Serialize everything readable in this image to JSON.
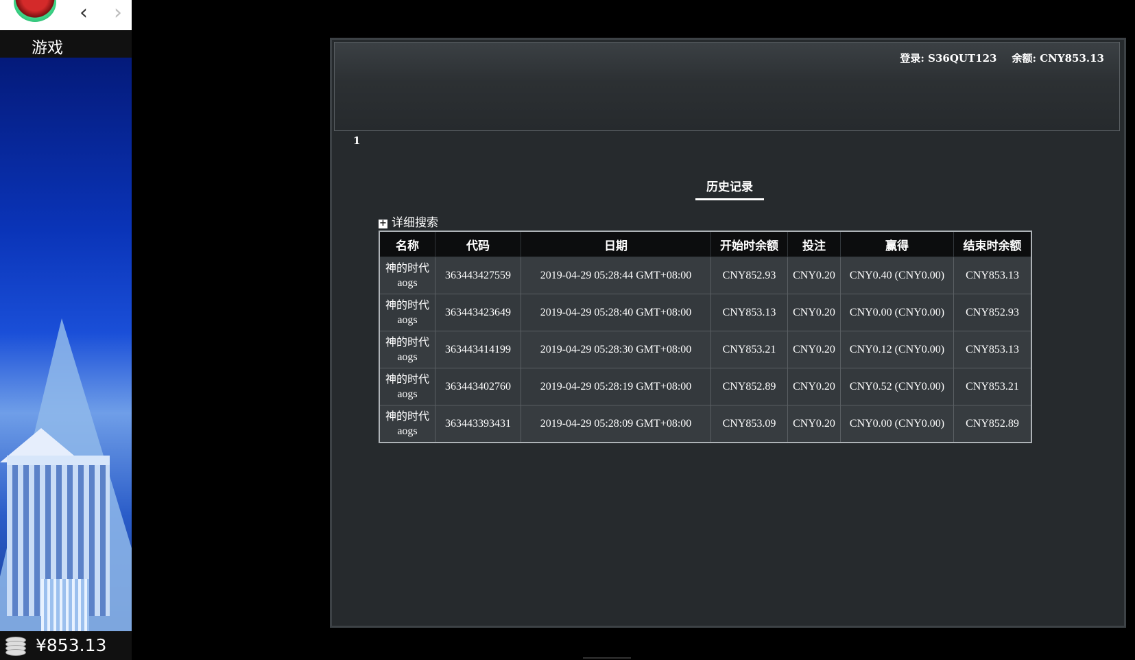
{
  "sidebar": {
    "title": "游戏",
    "balance": "¥853.13",
    "icons": [
      "logo-icon",
      "back-arrow-icon",
      "forward-arrow-icon",
      "coins-icon"
    ]
  },
  "header": {
    "login_label": "登录: S36QUT123",
    "balance_label": "余额: CNY853.13"
  },
  "page_number": "1",
  "history": {
    "title": "历史记录",
    "search_toggle": "详细搜索",
    "columns": [
      "名称",
      "代码",
      "日期",
      "开始时余额",
      "投注",
      "赢得",
      "结束时余额"
    ],
    "rows": [
      {
        "name_cn": "神的时代",
        "name_en": "aogs",
        "code": "363443427559",
        "date": "2019-04-29 05:28:44 GMT+08:00",
        "start": "CNY852.93",
        "bet": "CNY0.20",
        "win": "CNY0.40 (CNY0.00)",
        "end": "CNY853.13"
      },
      {
        "name_cn": "神的时代",
        "name_en": "aogs",
        "code": "363443423649",
        "date": "2019-04-29 05:28:40 GMT+08:00",
        "start": "CNY853.13",
        "bet": "CNY0.20",
        "win": "CNY0.00 (CNY0.00)",
        "end": "CNY852.93"
      },
      {
        "name_cn": "神的时代",
        "name_en": "aogs",
        "code": "363443414199",
        "date": "2019-04-29 05:28:30 GMT+08:00",
        "start": "CNY853.21",
        "bet": "CNY0.20",
        "win": "CNY0.12 (CNY0.00)",
        "end": "CNY853.13"
      },
      {
        "name_cn": "神的时代",
        "name_en": "aogs",
        "code": "363443402760",
        "date": "2019-04-29 05:28:19 GMT+08:00",
        "start": "CNY852.89",
        "bet": "CNY0.20",
        "win": "CNY0.52 (CNY0.00)",
        "end": "CNY853.21"
      },
      {
        "name_cn": "神的时代",
        "name_en": "aogs",
        "code": "363443393431",
        "date": "2019-04-29 05:28:09 GMT+08:00",
        "start": "CNY853.09",
        "bet": "CNY0.20",
        "win": "CNY0.00 (CNY0.00)",
        "end": "CNY852.89"
      }
    ]
  }
}
